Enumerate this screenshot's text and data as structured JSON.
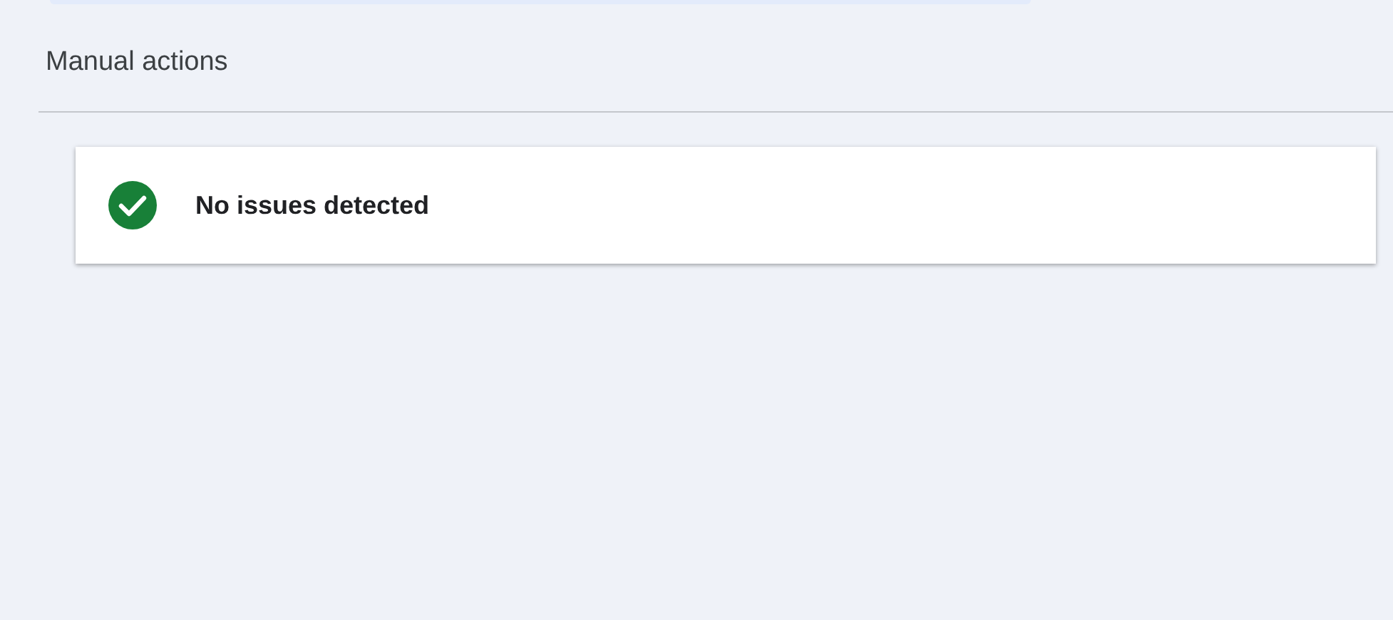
{
  "section": {
    "title": "Manual actions"
  },
  "status_card": {
    "kind": "ok",
    "message": "No issues detected"
  }
}
